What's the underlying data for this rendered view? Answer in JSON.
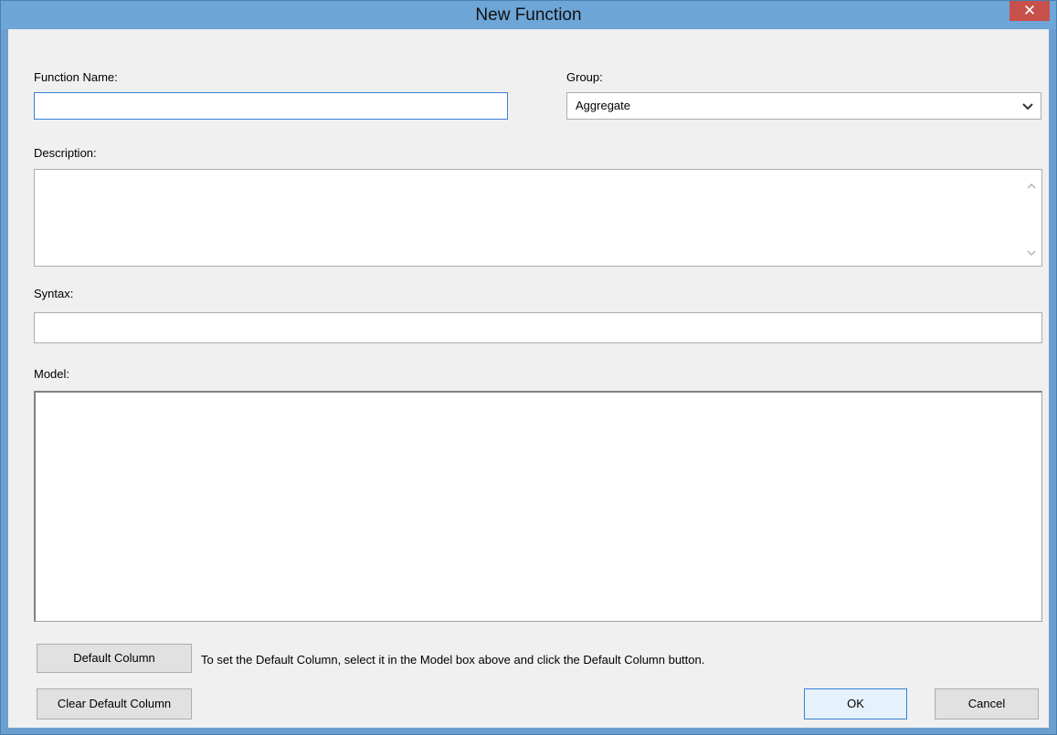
{
  "window": {
    "title": "New Function",
    "close_glyph": "✕"
  },
  "form": {
    "function_name_label": "Function Name:",
    "function_name_value": "",
    "group_label": "Group:",
    "group_value": "Aggregate",
    "description_label": "Description:",
    "description_value": "",
    "syntax_label": "Syntax:",
    "syntax_value": "",
    "model_label": "Model:",
    "model_value": ""
  },
  "buttons": {
    "default_column": "Default Column",
    "clear_default_column": "Clear Default Column",
    "ok": "OK",
    "cancel": "Cancel"
  },
  "hint": "To set the Default Column, select it in the Model box above and click the Default Column button.",
  "icons": {
    "close": "close-icon",
    "dropdown": "chevron-down-icon",
    "scroll_up": "scroll-up-arrow-icon",
    "scroll_down": "scroll-down-arrow-icon"
  },
  "colors": {
    "titlebar": "#6ea6d8",
    "close_button": "#c7504b",
    "client_background": "#f0f0f0",
    "focus_border": "#3c7fd8"
  }
}
